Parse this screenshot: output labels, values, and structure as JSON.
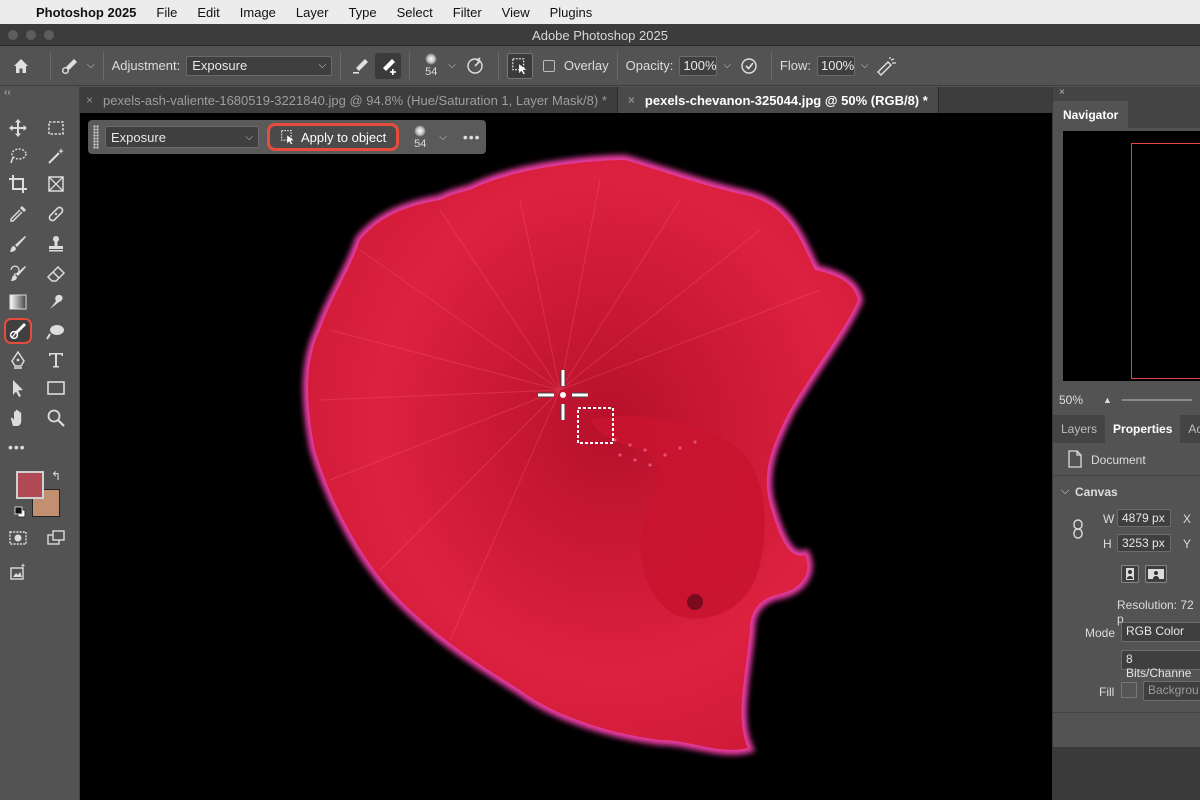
{
  "menubar": {
    "app": "Photoshop 2025",
    "items": [
      "File",
      "Edit",
      "Image",
      "Layer",
      "Type",
      "Select",
      "Filter",
      "View",
      "Plugins"
    ]
  },
  "window": {
    "title": "Adobe Photoshop 2025"
  },
  "options_bar": {
    "adjustment_label": "Adjustment:",
    "adjustment_value": "Exposure",
    "brush_size": "54",
    "overlay_label": "Overlay",
    "opacity_label": "Opacity:",
    "opacity_value": "100%",
    "flow_label": "Flow:",
    "flow_value": "100%"
  },
  "tabs": [
    {
      "label": "pexels-ash-valiente-1680519-3221840.jpg @ 94.8% (Hue/Saturation 1, Layer Mask/8) *",
      "active": false
    },
    {
      "label": "pexels-chevanon-325044.jpg @ 50% (RGB/8) *",
      "active": true
    }
  ],
  "context_bar": {
    "adjustment_value": "Exposure",
    "apply_label": "Apply to object",
    "brush_size": "54",
    "more": "•••"
  },
  "toolbar": {
    "more": "•••",
    "foreground_color": "#b04a55",
    "background_color": "#c09070",
    "active_tool": "adjustment-brush"
  },
  "navigator": {
    "tab": "Navigator",
    "zoom": "50%"
  },
  "panels": {
    "tabs": [
      "Layers",
      "Properties",
      "Ac"
    ],
    "active": "Properties",
    "document_label": "Document",
    "canvas_header": "Canvas",
    "w_label": "W",
    "w_value": "4879 px",
    "h_label": "H",
    "h_value": "3253 px",
    "x_label": "X",
    "y_label": "Y",
    "resolution": "Resolution: 72 p",
    "mode_label": "Mode",
    "mode_value": "RGB Color",
    "bits_value": "8 Bits/Channe",
    "fill_label": "Fill",
    "fill_value": "Backgrou"
  },
  "colors": {
    "accent_highlight": "#e84c3d",
    "selection_glow": "#ff3fa6",
    "fish_red": "#d81e3c"
  }
}
